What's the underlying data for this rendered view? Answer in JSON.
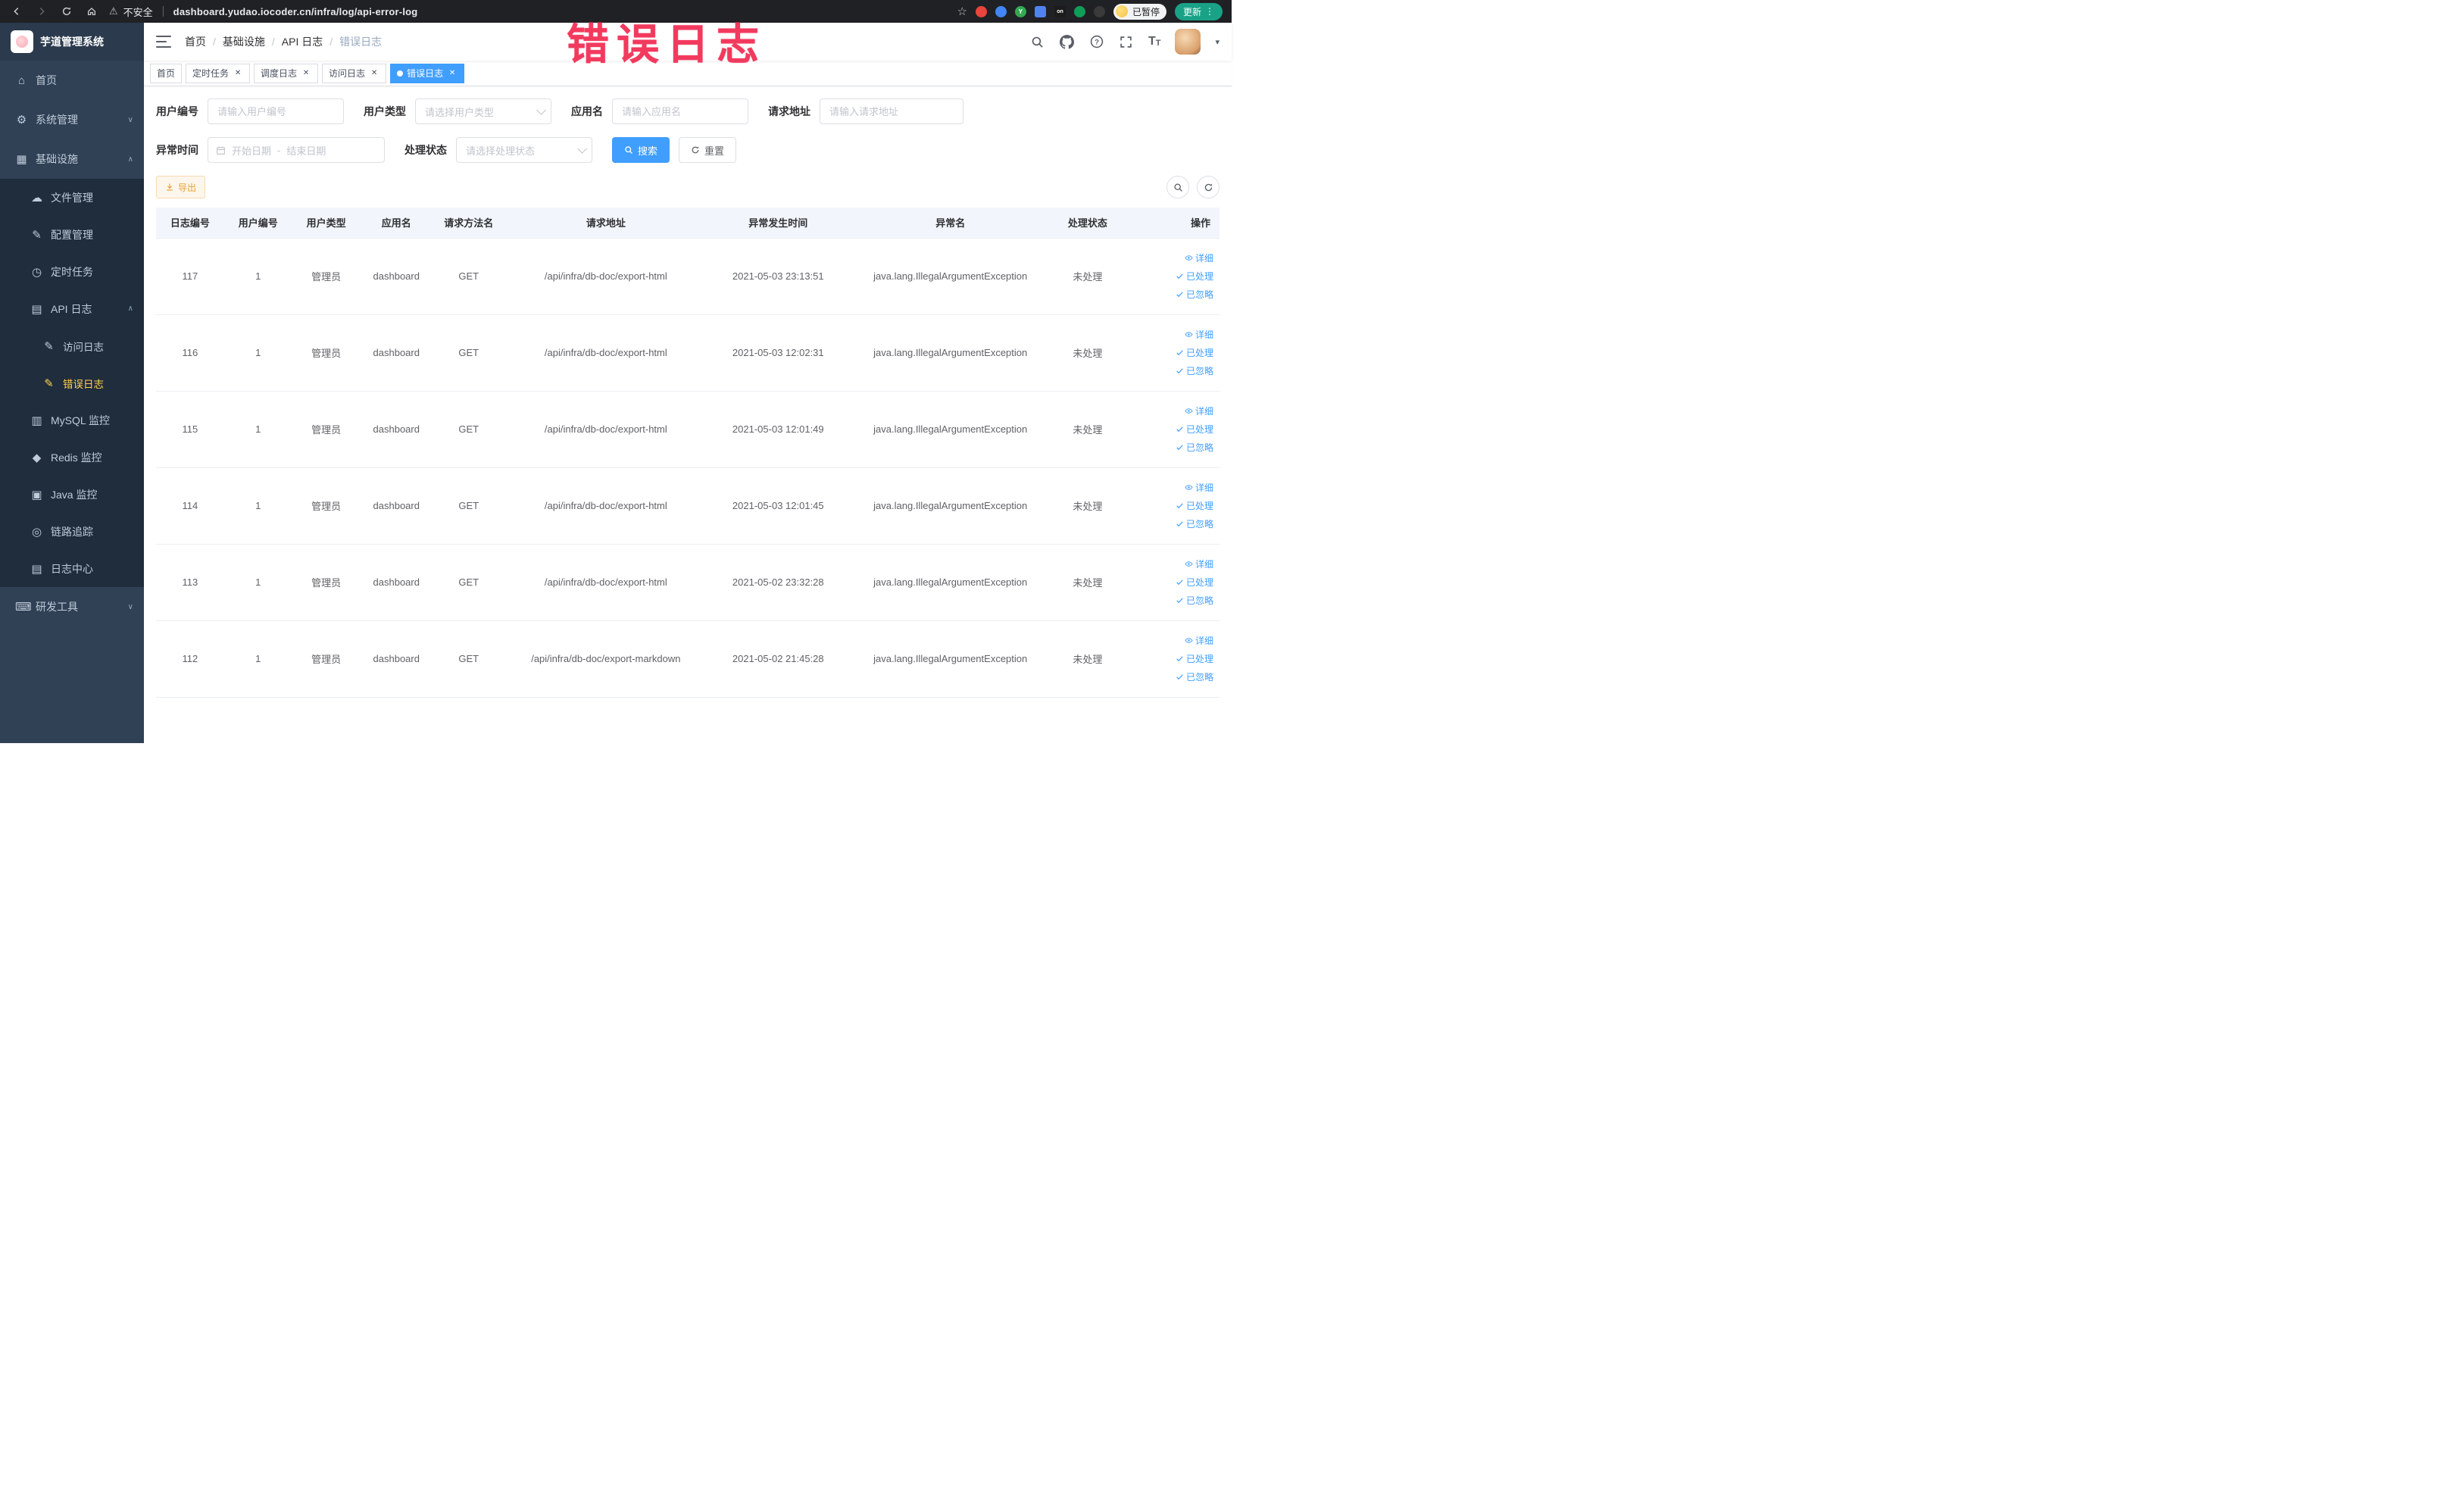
{
  "colors": {
    "primary": "#409EFF",
    "sidebar_active": "#FFD04B",
    "warning": "#E6A23C",
    "annotation_red": "#F23A5E",
    "tag_active": "#409EFF"
  },
  "annotation": {
    "text": "错误日志"
  },
  "browser": {
    "security_label": "不安全",
    "url": "dashboard.yudao.iocoder.cn/infra/log/api-error-log",
    "extension_y_label": "Y",
    "extension_on_label": "on",
    "paused_badge": "已暂停",
    "update_button": "更新"
  },
  "sidebar": {
    "logo_title": "芋道管理系统",
    "home": "首页",
    "system_mgmt": "系统管理",
    "infrastructure": "基础设施",
    "infra_children": {
      "file_mgmt": "文件管理",
      "config_mgmt": "配置管理",
      "cron_job": "定时任务",
      "api_log": "API 日志",
      "access_log": "访问日志",
      "error_log": "错误日志",
      "mysql": "MySQL 监控",
      "redis": "Redis 监控",
      "java": "Java 监控",
      "tracing": "链路追踪",
      "log_center": "日志中心"
    },
    "dev_tools": "研发工具"
  },
  "breadcrumb": {
    "separator": "/",
    "items": [
      "首页",
      "基础设施",
      "API 日志",
      "错误日志"
    ]
  },
  "tags": [
    {
      "label": "首页",
      "closable": false,
      "active": false
    },
    {
      "label": "定时任务",
      "closable": true,
      "active": false
    },
    {
      "label": "调度日志",
      "closable": true,
      "active": false
    },
    {
      "label": "访问日志",
      "closable": true,
      "active": false
    },
    {
      "label": "错误日志",
      "closable": true,
      "active": true
    }
  ],
  "filters": {
    "user_id": {
      "label": "用户编号",
      "placeholder": "请输入用户编号"
    },
    "user_type": {
      "label": "用户类型",
      "placeholder": "请选择用户类型"
    },
    "app_name": {
      "label": "应用名",
      "placeholder": "请输入应用名"
    },
    "request_url": {
      "label": "请求地址",
      "placeholder": "请输入请求地址"
    },
    "exception_time": {
      "label": "异常时间",
      "start_placeholder": "开始日期",
      "separator": "-",
      "end_placeholder": "结束日期"
    },
    "process_status": {
      "label": "处理状态",
      "placeholder": "请选择处理状态"
    },
    "search_button": "搜索",
    "reset_button": "重置"
  },
  "toolbar": {
    "export_label": "导出"
  },
  "table": {
    "columns": [
      "日志编号",
      "用户编号",
      "用户类型",
      "应用名",
      "请求方法名",
      "请求地址",
      "异常发生时间",
      "异常名",
      "处理状态",
      "操作"
    ],
    "rows": [
      {
        "id": "117",
        "user_id": "1",
        "user_type": "管理员",
        "app": "dashboard",
        "method": "GET",
        "url": "/api/infra/db-doc/export-html",
        "time": "2021-05-03 23:13:51",
        "exception": "java.lang.IllegalArgumentException",
        "status": "未处理"
      },
      {
        "id": "116",
        "user_id": "1",
        "user_type": "管理员",
        "app": "dashboard",
        "method": "GET",
        "url": "/api/infra/db-doc/export-html",
        "time": "2021-05-03 12:02:31",
        "exception": "java.lang.IllegalArgumentException",
        "status": "未处理"
      },
      {
        "id": "115",
        "user_id": "1",
        "user_type": "管理员",
        "app": "dashboard",
        "method": "GET",
        "url": "/api/infra/db-doc/export-html",
        "time": "2021-05-03 12:01:49",
        "exception": "java.lang.IllegalArgumentException",
        "status": "未处理"
      },
      {
        "id": "114",
        "user_id": "1",
        "user_type": "管理员",
        "app": "dashboard",
        "method": "GET",
        "url": "/api/infra/db-doc/export-html",
        "time": "2021-05-03 12:01:45",
        "exception": "java.lang.IllegalArgumentException",
        "status": "未处理"
      },
      {
        "id": "113",
        "user_id": "1",
        "user_type": "管理员",
        "app": "dashboard",
        "method": "GET",
        "url": "/api/infra/db-doc/export-html",
        "time": "2021-05-02 23:32:28",
        "exception": "java.lang.IllegalArgumentException",
        "status": "未处理"
      },
      {
        "id": "112",
        "user_id": "1",
        "user_type": "管理员",
        "app": "dashboard",
        "method": "GET",
        "url": "/api/infra/db-doc/export-markdown",
        "time": "2021-05-02 21:45:28",
        "exception": "java.lang.IllegalArgumentException",
        "status": "未处理"
      }
    ]
  },
  "row_actions": {
    "detail": "详细",
    "processed": "已处理",
    "ignored": "已忽略"
  }
}
